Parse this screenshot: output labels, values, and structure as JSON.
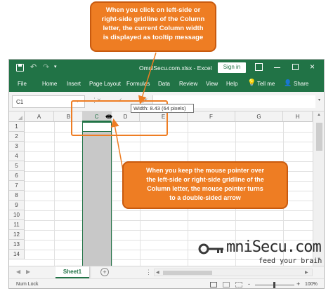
{
  "callouts": {
    "top": {
      "lines": [
        "When you click on left-side or",
        "right-side gridline of the Column",
        "letter, the current Column width",
        "is displayed as tooltip message"
      ]
    },
    "right": {
      "lines": [
        "When you keep the mouse pointer over",
        "the left-side or right-side gridline of the",
        "Column letter, the mouse pointer turns",
        "to a double-sided arrow"
      ]
    }
  },
  "window": {
    "title": "OmniSecu.com.xlsx  -  Excel",
    "signin": "Sign in"
  },
  "ribbon": {
    "tabs": [
      "File",
      "Home",
      "Insert",
      "Page Layout",
      "Formulas",
      "Data",
      "Review",
      "View",
      "Help"
    ],
    "tell_me": "Tell me",
    "share": "Share"
  },
  "formula_bar": {
    "name_box": "C1",
    "tooltip": "Width: 8.43 (64 pixels)"
  },
  "grid": {
    "columns": [
      "A",
      "B",
      "C",
      "D",
      "E",
      "F",
      "G",
      "H"
    ],
    "rows": [
      "1",
      "2",
      "3",
      "4",
      "5",
      "6",
      "7",
      "8",
      "9",
      "10",
      "11",
      "12",
      "13",
      "14"
    ]
  },
  "sheets": {
    "active": "Sheet1",
    "add_symbol": "+"
  },
  "status": {
    "mode": "Num Lock",
    "zoom": "100%",
    "zoom_minus": "-",
    "zoom_plus": "+"
  },
  "logo": {
    "brand": "mniSecu.com",
    "tagline": "feed your brain"
  },
  "colors": {
    "excel_green": "#217346",
    "callout_orange": "#ee7d23",
    "selection_gray": "#c8c8c8"
  }
}
